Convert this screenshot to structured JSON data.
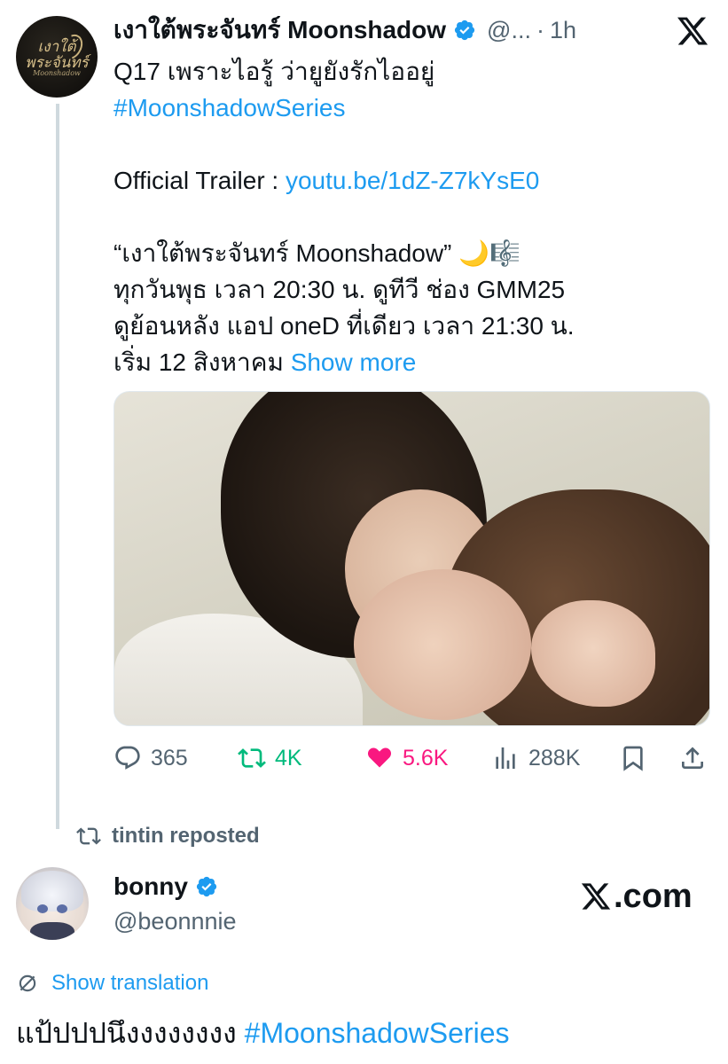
{
  "original_post": {
    "avatar_logo_text": "เงาใต้พระจันทร์",
    "avatar_logo_sub": "Moonshadow",
    "author_name": "เงาใต้พระจันทร์ Moonshadow",
    "handle": "@...",
    "dot": "·",
    "time": "1h",
    "text_lines": {
      "l1": "Q17 เพราะไอรู้ ว่ายูยังรักไออยู่",
      "l2_hashtag": "#MoonshadowSeries",
      "l3_prefix": "Official Trailer : ",
      "l3_link": "youtu.be/1dZ-Z7kYsE0",
      "l4": "“เงาใต้พระจันทร์ Moonshadow” 🌙🎼",
      "l5": "ทุกวันพุธ เวลา 20:30 น. ดูทีวี ช่อง GMM25",
      "l6": "ดูย้อนหลัง แอป oneD ที่เดียว เวลา 21:30 น.",
      "l7_prefix": "เริ่ม 12 สิงหาคม ",
      "l7_more": "Show more"
    },
    "media_alt": "photo",
    "stats": {
      "replies": "365",
      "reposts": "4K",
      "likes": "5.6K",
      "views": "288K"
    }
  },
  "repost_banner": "tintin reposted",
  "reply_post": {
    "author_name": "bonny",
    "handle": "@beonnnie",
    "watermark": ".com",
    "show_translation": "Show translation",
    "text": "แป้ปปปนึงงงงงงงง ",
    "hashtag": "#MoonshadowSeries"
  },
  "colors": {
    "accent": "#1d9bf0",
    "repost_green": "#00ba7c",
    "like_pink": "#f91880",
    "muted": "#536471",
    "text": "#0f1419"
  },
  "icons": [
    "x-logo-icon",
    "verified-badge-icon",
    "reply-icon",
    "repost-icon",
    "like-heart-icon",
    "views-icon",
    "bookmark-icon",
    "share-icon",
    "translate-icon"
  ]
}
